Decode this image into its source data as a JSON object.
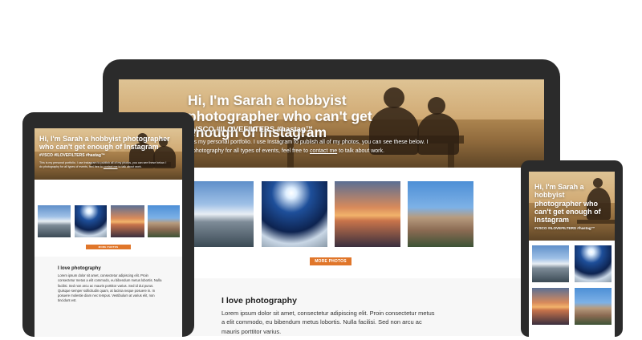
{
  "hero": {
    "title": "Hi, I'm Sarah a hobbyist photographer who can't get enough of Instagram",
    "tags": "#VSCO #ILOVEFILTERS #hastag™",
    "text_before_link": "This is my personal portfolio. I use Instagram to publish all of my photos, you can see these below. I do photography for all types of events, feel free to ",
    "link_label": "contact me",
    "text_after_link": " to talk about work.",
    "text_before_link_cropped": "is my personal portfolio. I use Instagram to publish all of my photos, you can see these below. I",
    "text_line2_cropped": "photography for all types of events, feel free to",
    "tag_cropped": "VSCO #ILOVEFILTERS #hastag™"
  },
  "photos": {
    "items": [
      {
        "name": "mountain-lake-photo"
      },
      {
        "name": "summit-starburst-photo"
      },
      {
        "name": "sunset-lake-photo"
      },
      {
        "name": "rock-spire-photo"
      }
    ]
  },
  "more_photos_label": "MORE PHOTOS",
  "about": {
    "title": "I love photography",
    "text": "Lorem ipsum dolor sit amet, consectetur adipiscing elit. Proin consectetur metus a elit commodo, eu bibendum metus lobortis. Nulla facilisi. Sed non arcu ac mauris porttitor varius. Sed id dui purus. Quisque semper sollicitudin quam, at lacinia neque posuere in. In posuere molestie diam nec tempus. Vestibulum at varius elit, non tincidunt est.",
    "text_desktop": "Lorem ipsum dolor sit amet, consectetur adipiscing elit. Proin consectetur metus a elit commodo, eu bibendum metus lobortis. Nulla facilisi. Sed non arcu ac mauris porttitor varius."
  },
  "colors": {
    "accent": "#e0762a",
    "device_frame": "#2b2b2b",
    "section_bg": "#f7f7f7"
  }
}
